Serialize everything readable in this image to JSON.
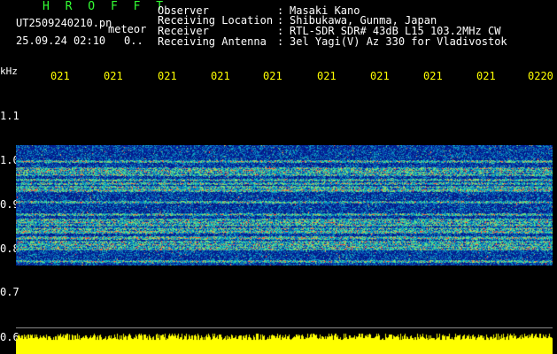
{
  "header": {
    "title": "H R O F F T",
    "file": "UT2509240210.pn",
    "mode": "meteor",
    "datetime": "25.09.24 02:10",
    "dots": "0..",
    "info": [
      {
        "label": "Observer",
        "sep": ":",
        "value": "Masaki Kano"
      },
      {
        "label": "Receiving Location",
        "sep": ":",
        "value": "Shibukawa, Gunma, Japan"
      },
      {
        "label": "Receiver",
        "sep": ":",
        "value": "RTL-SDR SDR# 43dB L15 103.2MHz CW"
      },
      {
        "label": "Receiving Antenna",
        "sep": ":",
        "value": "3el Yagi(V) Az 330 for Vladivostok"
      }
    ]
  },
  "axis": {
    "unit": "kHz",
    "x_ticks": [
      "021",
      "021",
      "021",
      "021",
      "021",
      "021",
      "021",
      "021",
      "021",
      "0220"
    ],
    "y_ticks": [
      "1.1",
      "1.0",
      "0.9",
      "0.8",
      "0.7",
      "0.6"
    ]
  },
  "colors": {
    "background": "#000000",
    "text_white": "#ffffff",
    "text_green": "#33ff33",
    "text_yellow": "#ffff00",
    "signal_low": "#0a1e9c",
    "signal_mid": "#18c8c0",
    "signal_high": "#ff3040",
    "level_bar": "#ffff00"
  }
}
